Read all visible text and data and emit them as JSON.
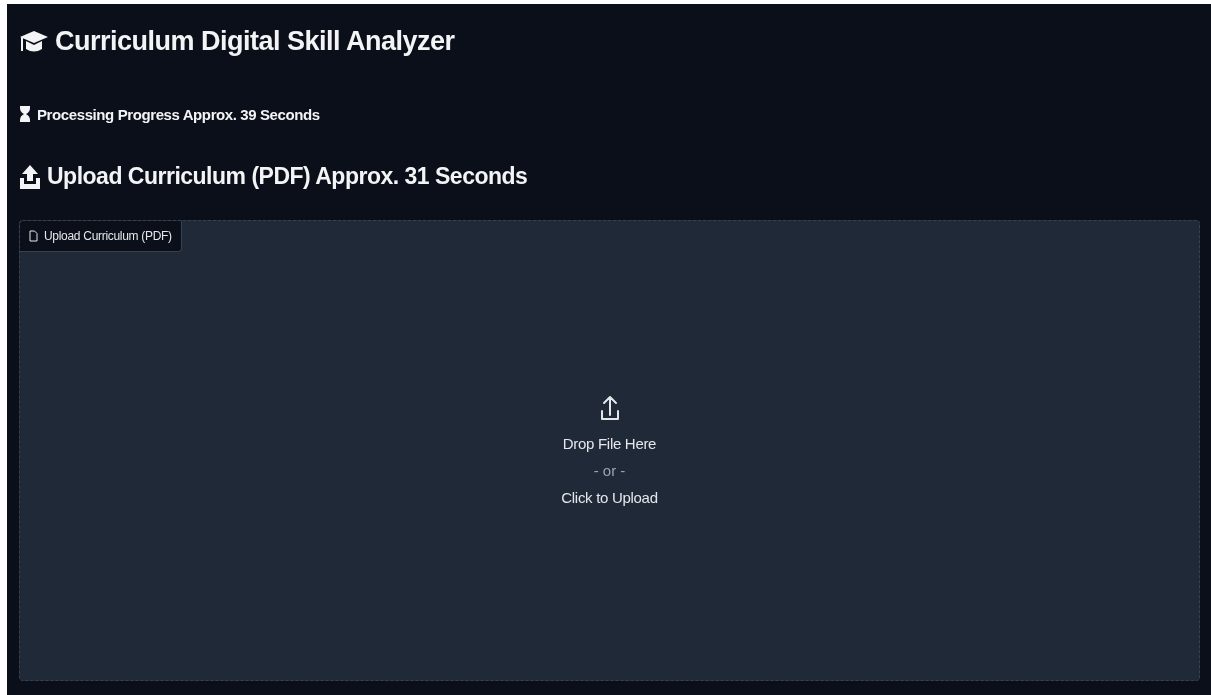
{
  "title": "Curriculum Digital Skill Analyzer",
  "progress": {
    "text": "Processing Progress Approx. 39 Seconds"
  },
  "upload_heading": "Upload Curriculum (PDF) Approx. 31 Seconds",
  "upload_field": {
    "label": "Upload Curriculum (PDF)",
    "drop_text": "Drop File Here",
    "or_text": "- or -",
    "click_text": "Click to Upload"
  }
}
